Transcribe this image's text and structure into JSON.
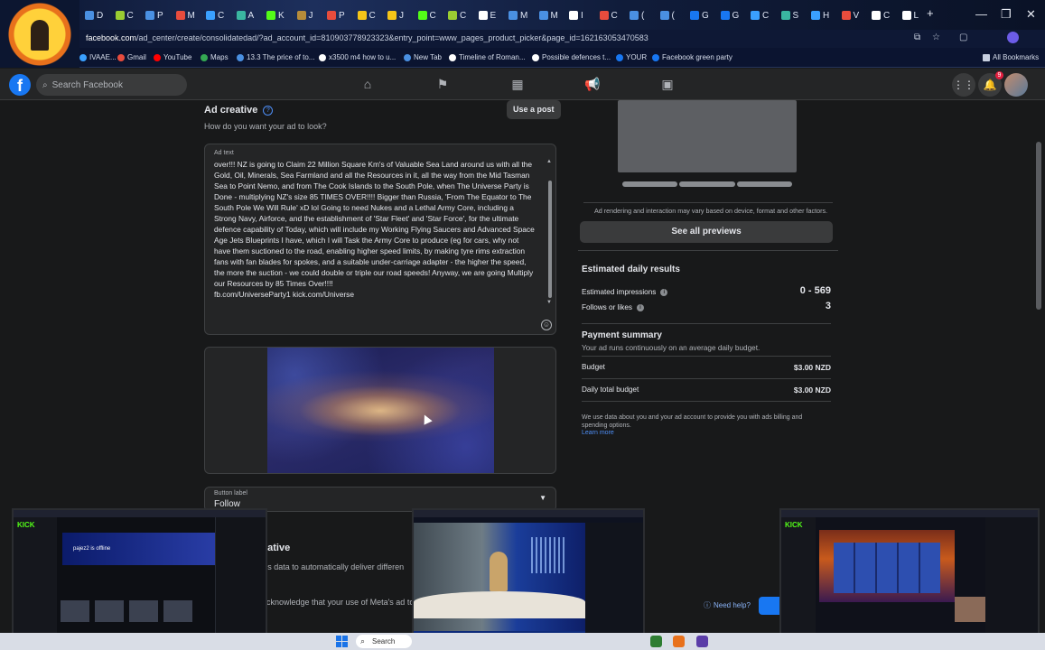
{
  "browser": {
    "tabs": [
      {
        "label": "D",
        "color": "#4a90e2"
      },
      {
        "label": "C",
        "color": "#9acd32"
      },
      {
        "label": "P",
        "color": "#4a90e2"
      },
      {
        "label": "M",
        "color": "#e84c3d"
      },
      {
        "label": "C",
        "color": "#3aa0ff"
      },
      {
        "label": "A",
        "color": "#3ab6a0"
      },
      {
        "label": "K",
        "color": "#53fc18"
      },
      {
        "label": "J",
        "color": "#b78c3a"
      },
      {
        "label": "P",
        "color": "#e74c3c"
      },
      {
        "label": "C",
        "color": "#f5c518"
      },
      {
        "label": "J",
        "color": "#f5c518"
      },
      {
        "label": "C",
        "color": "#53fc18"
      },
      {
        "label": "C",
        "color": "#9acd32"
      },
      {
        "label": "E",
        "color": "#ffffff"
      },
      {
        "label": "M",
        "color": "#4a90e2"
      },
      {
        "label": "M",
        "color": "#4a90e2"
      },
      {
        "label": "I",
        "color": "#ffffff"
      },
      {
        "label": "C",
        "color": "#e84c3d"
      },
      {
        "label": "(",
        "color": "#4a90e2"
      },
      {
        "label": "(",
        "color": "#4a90e2"
      },
      {
        "label": "G",
        "color": "#1877f2"
      },
      {
        "label": "G",
        "color": "#1877f2"
      },
      {
        "label": "C",
        "color": "#3aa0ff"
      },
      {
        "label": "S",
        "color": "#3ab6a0"
      },
      {
        "label": "H",
        "color": "#3aa0ff"
      },
      {
        "label": "V",
        "color": "#e84c3d"
      },
      {
        "label": "C",
        "color": "#ffffff"
      },
      {
        "label": "L",
        "color": "#ffffff"
      }
    ],
    "new_tab": "+",
    "window_controls": {
      "minimize": "—",
      "restore": "❐",
      "close": "✕"
    },
    "url_host": "facebook.com",
    "url_rest": "/ad_center/create/consolidatedad/?ad_account_id=810903778923323&entry_point=www_pages_product_picker&page_id=162163053470583",
    "bookmarks": [
      {
        "label": "IVAAE...",
        "color": "#3aa0ff"
      },
      {
        "label": "Gmail",
        "color": "#e84c3d"
      },
      {
        "label": "YouTube",
        "color": "#ff0000"
      },
      {
        "label": "Maps",
        "color": "#34a853"
      },
      {
        "label": "13.3 The price of to...",
        "color": "#4a90e2"
      },
      {
        "label": "x3500 m4 how to u...",
        "color": "#ffffff"
      },
      {
        "label": "New Tab",
        "color": "#4a90e2"
      },
      {
        "label": "Timeline of Roman...",
        "color": "#ffffff"
      },
      {
        "label": "Possible defences t...",
        "color": "#ffffff"
      },
      {
        "label": "YOUR",
        "color": "#1877f2"
      },
      {
        "label": "Facebook green party",
        "color": "#1877f2"
      }
    ],
    "all_bookmarks": "All Bookmarks"
  },
  "fb": {
    "search_placeholder": "Search Facebook",
    "nav_icons": [
      "home-icon",
      "flag-icon",
      "marketplace-icon",
      "megaphone-icon",
      "gaming-icon"
    ],
    "notification_count": "9"
  },
  "ad_creative": {
    "title": "Ad creative",
    "subtitle": "How do you want your ad to look?",
    "use_post": "Use a post",
    "ad_text_label": "Ad text",
    "ad_text": "over!!! NZ is going to Claim 22 Million Square Km's of Valuable Sea Land around us with all the Gold, Oil, Minerals, Sea Farmland and all the Resources in it, all the way from the Mid Tasman Sea to Point Nemo, and from The Cook Islands to the South Pole, when The Universe Party is Done - multiplying NZ's size 85 TIMES OVER!!!! Bigger than Russia, 'From The Equator to The South Pole We Will Rule' xD lol Going to need Nukes and a Lethal Army Core, including a Strong Navy, Airforce, and the establishment of 'Star Fleet' and 'Star Force', for the ultimate defence capability of Today, which will include my Working Flying Saucers and Advanced Space Age Jets Blueprints I have, which I will Task the Army Core to produce (eg for cars, why not have them suctioned to the road, enabling higher speed limits, by making tyre rims extraction fans with fan blades for spokes, and a suitable under-carriage adapter - the higher the speed, the more the suction - we could double or triple our road speeds! Anyway, we are going Multiply our Resources by 85 Times Over!!!!",
    "ad_text_links": "fb.com/UniverseParty1 kick.com/Universe",
    "button_label_title": "Button label",
    "button_label_value": "Follow",
    "partial_heading": "eative",
    "partial_line1": "k's data to automatically deliver differen",
    "partial_line2": "acknowledge that your use of Meta's ad tools"
  },
  "preview": {
    "note": "Ad rendering and interaction may vary based on device, format and other factors.",
    "see_all": "See all previews"
  },
  "results": {
    "title": "Estimated daily results",
    "impressions_label": "Estimated impressions",
    "impressions_value": "0 - 569",
    "follows_label": "Follows or likes",
    "follows_value": "3"
  },
  "payment": {
    "title": "Payment summary",
    "subtitle": "Your ad runs continuously on an average daily budget.",
    "budget_label": "Budget",
    "budget_value": "$3.00 NZD",
    "daily_total_label": "Daily total budget",
    "daily_total_value": "$3.00 NZD",
    "fineprint": "We use data about you and your ad account to provide you with ads billing and spending options.",
    "learn_more": "Learn more"
  },
  "need_help": "Need help?",
  "overlays": {
    "left_logo": "KICK",
    "left_status": "pajez2 is offline",
    "right_logo": "KICK"
  },
  "taskbar": {
    "search_label": "Search"
  }
}
